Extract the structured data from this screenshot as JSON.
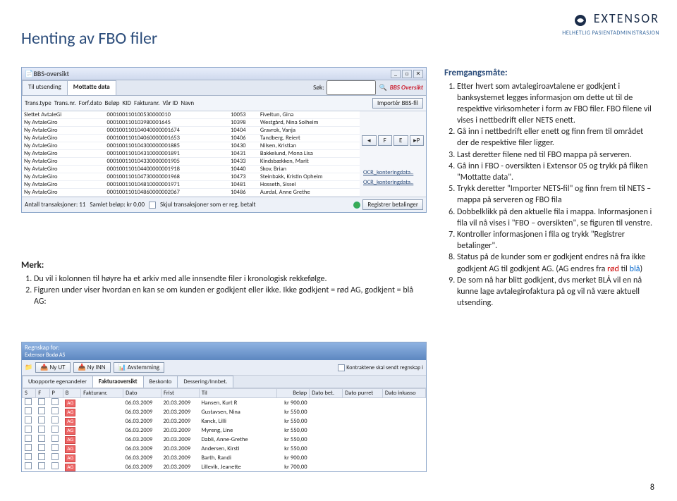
{
  "page_title": "Henting av FBO filer",
  "page_number": "8",
  "logo": {
    "brand": "EXTENSOR",
    "sub": "HELHETLIG PASIENTADMINISTRASJON"
  },
  "bbs_window": {
    "title": "BBS-oversikt",
    "tabs": {
      "t1": "Til utsending",
      "t2": "Mottatte data",
      "search_label": "Søk:",
      "bbs_label": "BBS Oversikt"
    },
    "row2": {
      "c1": "Trans.type",
      "c2": "Trans.nr.",
      "c3": "Forf.dato",
      "c4": "Beløp",
      "c5": "KID",
      "c6": "Fakturanr.",
      "c7": "Vår ID",
      "c8": "Navn",
      "import_btn": "Importér BBS-fil"
    },
    "nav": {
      "f": "F",
      "e": "E",
      "p": "P"
    },
    "rows": [
      {
        "type": "Slettet AvtaleGi",
        "kid": "000100110100530000010",
        "id": "10053",
        "navn": "Fiveltun, Gina"
      },
      {
        "type": "Ny AvtaleGiro",
        "kid": "000100110103980001645",
        "id": "10398",
        "navn": "Westgård, Nina Solheim"
      },
      {
        "type": "Ny AvtaleGiro",
        "kid": "000100110104040000001674",
        "id": "10404",
        "navn": "Gravrok, Vanja"
      },
      {
        "type": "Ny AvtaleGiro",
        "kid": "000100110104060000001653",
        "id": "10406",
        "navn": "Tandberg, Reiert"
      },
      {
        "type": "Ny AvtaleGiro",
        "kid": "000100110104300000001885",
        "id": "10430",
        "navn": "Nilsen, Kristian"
      },
      {
        "type": "Ny AvtaleGiro",
        "kid": "000100110104310000001891",
        "id": "10431",
        "navn": "Bakkelund, Mona Lisa"
      },
      {
        "type": "Ny AvtaleGiro",
        "kid": "000100110104330000001905",
        "id": "10433",
        "navn": "Kindsbækken, Marit"
      },
      {
        "type": "Ny AvtaleGiro",
        "kid": "000100110104400000001918",
        "id": "10440",
        "navn": "Skov, Brian"
      },
      {
        "type": "Ny AvtaleGiro",
        "kid": "000100110104730000001968",
        "id": "10473",
        "navn": "Steinbakk, Kristin Opheim"
      },
      {
        "type": "Ny AvtaleGiro",
        "kid": "000100110104810000001971",
        "id": "10481",
        "navn": "Hosseth, Sissel"
      },
      {
        "type": "Ny AvtaleGiro",
        "kid": "000100110104860000002067",
        "id": "10486",
        "navn": "Aurdal, Anne Grethe"
      }
    ],
    "side_links": {
      "l1": "OCR_konteringdata..",
      "l2": "OCR_konteringdata.."
    },
    "footer": {
      "count_label": "Antall transaksjoner:  11",
      "sum_label": "Samlet beløp:   kr 0,00",
      "skjul_label": "Skjul transaksjoner som er reg. betalt",
      "reg_btn": "Registrer betalinger"
    }
  },
  "merk": {
    "heading": "Merk:",
    "items": [
      "Du vil i kolonnen til høyre ha et arkiv med alle innsendte filer i kronologisk rekkefølge.",
      "Figuren under viser hvordan en kan se om kunden er godkjent eller ikke. Ikke godkjent = rød AG, godkjent = blå AG:"
    ]
  },
  "frem": {
    "heading": "Fremgangsmåte:",
    "items": [
      "Etter hvert som avtalegiroavtalene er godkjent i banksystemet legges informasjon om dette ut til de respektive virksomheter i form av FBO filer. FBO filene vil vises i nettbedrift eller NETS enett.",
      "Gå inn i nettbedrift eller enett og finn frem til området der de respektive filer ligger.",
      "Last deretter filene ned til FBO mappa på serveren.",
      "Gå inn i FBO - oversikten i Extensor 05 og trykk på fliken \"Mottatte data\".",
      "Trykk deretter \"Importer NETS-fil\" og finn frem til NETS – mappa på serveren og FBO fila",
      "Dobbelklikk på den aktuelle fila i mappa. Informasjonen i fila vil nå vises i \"FBO – oversikten\", se figuren til venstre.",
      "Kontroller informasjonen i fila og trykk \"Registrer betalinger\".",
      "Status på de kunder som er godkjent endres nå fra ikke godkjent AG til godkjent AG. (AG endres fra ",
      "De som nå har blitt godkjent, dvs  merket BLÅ vil en nå kunne lage avtalegirofaktura på og vil nå være aktuell utsending."
    ],
    "item8_red": "rød",
    "item8_mid": " til ",
    "item8_blue": "blå",
    "item8_end": ")"
  },
  "faktura": {
    "top_line1": "Regnskap for:",
    "top_line2": "Extensor Bodø AS",
    "buttons": {
      "b1": "Ny UT",
      "b2": "Ny INN",
      "b3": "Avstemming",
      "right": "Kontraktene skal sendt regnskap i"
    },
    "tabs": {
      "t1": "Ubopporte egenandeler",
      "t2": "Fakturaoversikt",
      "t3": "Beskonto",
      "t4": "Dessering/Innbet."
    },
    "headers": {
      "h0": "S",
      "h1": "F",
      "h2": "P",
      "h3": "B",
      "h4": "Fakturanr.",
      "h5": "Dato",
      "h6": "Frist",
      "h7": "Til",
      "h8": "Beløp",
      "h9": "Dato bet.",
      "h10": "Dato purret",
      "h11": "Dato inkasso"
    },
    "rows": [
      {
        "dato": "06.03.2009",
        "frist": "20.03.2009",
        "til": "Hansen, Kurt R",
        "belop": "kr 900,00"
      },
      {
        "dato": "06.03.2009",
        "frist": "20.03.2009",
        "til": "Gustavsen, Nina",
        "belop": "kr 550,00"
      },
      {
        "dato": "06.03.2009",
        "frist": "20.03.2009",
        "til": "Kanck, Lilli",
        "belop": "kr 550,00"
      },
      {
        "dato": "06.03.2009",
        "frist": "20.03.2009",
        "til": "Myreng, Line",
        "belop": "kr 550,00"
      },
      {
        "dato": "06.03.2009",
        "frist": "20.03.2009",
        "til": "Dabli, Anne-Grethe",
        "belop": "kr 550,00"
      },
      {
        "dato": "06.03.2009",
        "frist": "20.03.2009",
        "til": "Andersen, Kirsti",
        "belop": "kr 550,00"
      },
      {
        "dato": "06.03.2009",
        "frist": "20.03.2009",
        "til": "Barth, Randi",
        "belop": "kr 900,00"
      },
      {
        "dato": "06.03.2009",
        "frist": "20.03.2009",
        "til": "Lillevik, Jeanette",
        "belop": "kr 700,00"
      }
    ]
  }
}
